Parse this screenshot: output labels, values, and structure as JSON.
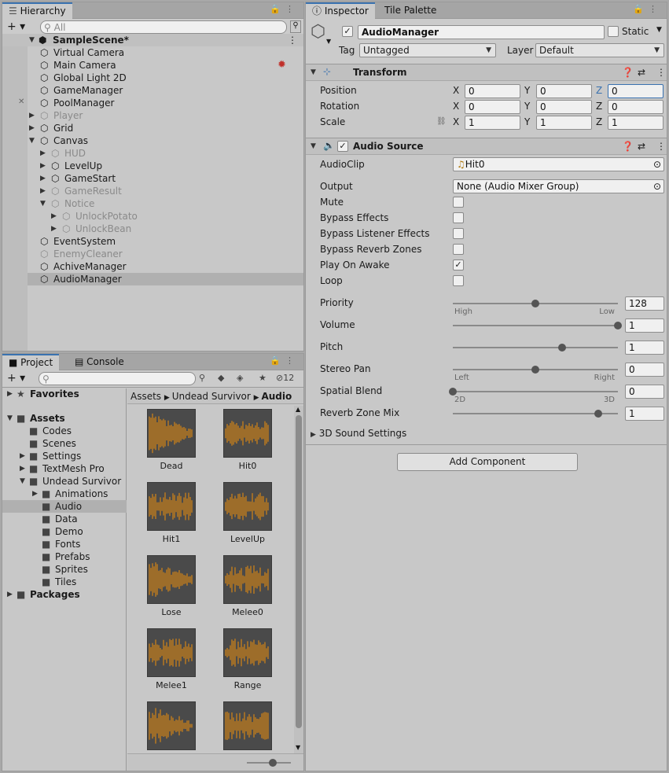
{
  "hierarchy": {
    "tab": "Hierarchy",
    "search_placeholder": "All",
    "scene": "SampleScene*",
    "items": [
      {
        "label": "Virtual Camera",
        "depth": 1,
        "dim": false,
        "arrow": ""
      },
      {
        "label": "Main Camera",
        "depth": 1,
        "dim": false,
        "arrow": ""
      },
      {
        "label": "Global Light 2D",
        "depth": 1,
        "dim": false,
        "arrow": ""
      },
      {
        "label": "GameManager",
        "depth": 1,
        "dim": false,
        "arrow": ""
      },
      {
        "label": "PoolManager",
        "depth": 1,
        "dim": false,
        "arrow": ""
      },
      {
        "label": "Player",
        "depth": 1,
        "dim": true,
        "arrow": "right"
      },
      {
        "label": "Grid",
        "depth": 1,
        "dim": false,
        "arrow": "right"
      },
      {
        "label": "Canvas",
        "depth": 1,
        "dim": false,
        "arrow": "down"
      },
      {
        "label": "HUD",
        "depth": 2,
        "dim": true,
        "arrow": "right"
      },
      {
        "label": "LevelUp",
        "depth": 2,
        "dim": false,
        "arrow": "right"
      },
      {
        "label": "GameStart",
        "depth": 2,
        "dim": false,
        "arrow": "right"
      },
      {
        "label": "GameResult",
        "depth": 2,
        "dim": true,
        "arrow": "right"
      },
      {
        "label": "Notice",
        "depth": 2,
        "dim": true,
        "arrow": "down"
      },
      {
        "label": "UnlockPotato",
        "depth": 3,
        "dim": true,
        "arrow": "right"
      },
      {
        "label": "UnlockBean",
        "depth": 3,
        "dim": true,
        "arrow": "right"
      },
      {
        "label": "EventSystem",
        "depth": 1,
        "dim": false,
        "arrow": ""
      },
      {
        "label": "EnemyCleaner",
        "depth": 1,
        "dim": true,
        "arrow": ""
      },
      {
        "label": "AchiveManager",
        "depth": 1,
        "dim": false,
        "arrow": ""
      },
      {
        "label": "AudioManager",
        "depth": 1,
        "dim": false,
        "arrow": "",
        "selected": true
      }
    ]
  },
  "project": {
    "tabs": [
      "Project",
      "Console"
    ],
    "hidden_count": "12",
    "tree": [
      {
        "label": "Favorites",
        "bold": true,
        "indent": 0,
        "arrow": "right",
        "icon": "star-icon"
      },
      {
        "label": "Assets",
        "bold": true,
        "indent": 0,
        "arrow": "down",
        "icon": "folder-icon"
      },
      {
        "label": "Codes",
        "bold": false,
        "indent": 1,
        "arrow": "",
        "icon": "folder-icon"
      },
      {
        "label": "Scenes",
        "bold": false,
        "indent": 1,
        "arrow": "",
        "icon": "folder-icon"
      },
      {
        "label": "Settings",
        "bold": false,
        "indent": 1,
        "arrow": "right",
        "icon": "folder-icon"
      },
      {
        "label": "TextMesh Pro",
        "bold": false,
        "indent": 1,
        "arrow": "right",
        "icon": "folder-icon"
      },
      {
        "label": "Undead Survivor",
        "bold": false,
        "indent": 1,
        "arrow": "down",
        "icon": "folder-icon"
      },
      {
        "label": "Animations",
        "bold": false,
        "indent": 2,
        "arrow": "right",
        "icon": "folder-icon"
      },
      {
        "label": "Audio",
        "bold": false,
        "indent": 2,
        "arrow": "",
        "icon": "folder-icon",
        "selected": true
      },
      {
        "label": "Data",
        "bold": false,
        "indent": 2,
        "arrow": "",
        "icon": "folder-icon"
      },
      {
        "label": "Demo",
        "bold": false,
        "indent": 2,
        "arrow": "",
        "icon": "folder-icon"
      },
      {
        "label": "Fonts",
        "bold": false,
        "indent": 2,
        "arrow": "",
        "icon": "folder-icon"
      },
      {
        "label": "Prefabs",
        "bold": false,
        "indent": 2,
        "arrow": "",
        "icon": "folder-icon"
      },
      {
        "label": "Sprites",
        "bold": false,
        "indent": 2,
        "arrow": "",
        "icon": "folder-icon"
      },
      {
        "label": "Tiles",
        "bold": false,
        "indent": 2,
        "arrow": "",
        "icon": "folder-icon"
      },
      {
        "label": "Packages",
        "bold": true,
        "indent": 0,
        "arrow": "right",
        "icon": "folder-icon"
      }
    ],
    "breadcrumb": [
      "Assets",
      "Undead Survivor",
      "Audio"
    ],
    "assets": [
      "Dead",
      "Hit0",
      "Hit1",
      "LevelUp",
      "Lose",
      "Melee0",
      "Melee1",
      "Range",
      "",
      ""
    ]
  },
  "inspector": {
    "tabs": [
      "Inspector",
      "Tile Palette"
    ],
    "object_name": "AudioManager",
    "static_label": "Static",
    "tag_label": "Tag",
    "tag_value": "Untagged",
    "layer_label": "Layer",
    "layer_value": "Default",
    "transform": {
      "title": "Transform",
      "rows": [
        {
          "label": "Position",
          "x": "0",
          "y": "0",
          "z": "0"
        },
        {
          "label": "Rotation",
          "x": "0",
          "y": "0",
          "z": "0"
        },
        {
          "label": "Scale",
          "x": "1",
          "y": "1",
          "z": "1"
        }
      ]
    },
    "audio_source": {
      "title": "Audio Source",
      "clip_label": "AudioClip",
      "clip_value": "Hit0",
      "output_label": "Output",
      "output_value": "None (Audio Mixer Group)",
      "toggles": [
        {
          "label": "Mute",
          "checked": false
        },
        {
          "label": "Bypass Effects",
          "checked": false
        },
        {
          "label": "Bypass Listener Effects",
          "checked": false
        },
        {
          "label": "Bypass Reverb Zones",
          "checked": false
        },
        {
          "label": "Play On Awake",
          "checked": true
        },
        {
          "label": "Loop",
          "checked": false
        }
      ],
      "sliders": [
        {
          "label": "Priority",
          "value": "128",
          "fraction": 0.5,
          "left": "High",
          "right": "Low"
        },
        {
          "label": "Volume",
          "value": "1",
          "fraction": 1.0,
          "left": "",
          "right": ""
        },
        {
          "label": "Pitch",
          "value": "1",
          "fraction": 0.66,
          "left": "",
          "right": ""
        },
        {
          "label": "Stereo Pan",
          "value": "0",
          "fraction": 0.5,
          "left": "Left",
          "right": "Right"
        },
        {
          "label": "Spatial Blend",
          "value": "0",
          "fraction": 0.0,
          "left": "2D",
          "right": "3D"
        },
        {
          "label": "Reverb Zone Mix",
          "value": "1",
          "fraction": 0.88,
          "left": "",
          "right": ""
        }
      ],
      "sound_settings": "3D Sound Settings"
    },
    "add_component": "Add Component"
  },
  "colors": {
    "accent": "#3a72b0",
    "waveform": "#f0900a",
    "selected_row": "#b0b0b0"
  }
}
